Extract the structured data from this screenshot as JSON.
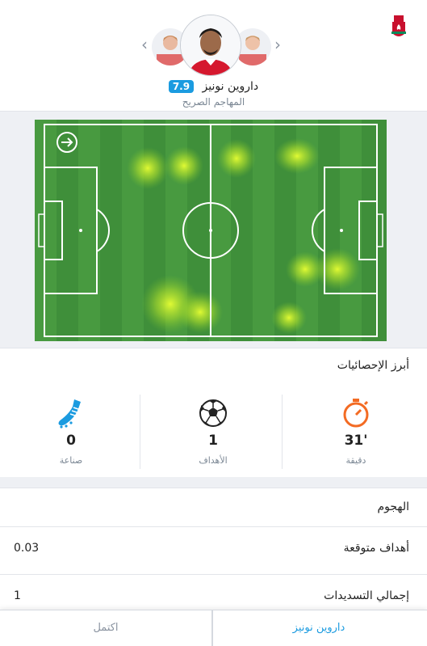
{
  "player": {
    "name": "داروين نونيز",
    "rating": "7.9",
    "position": "المهاجم الصريح"
  },
  "nav": {
    "prev_icon": "chevron-left",
    "next_icon": "chevron-right"
  },
  "club": {
    "logo": "liverpool-crest"
  },
  "stats": {
    "title": "أبرز الإحصائيات",
    "items": [
      {
        "icon": "stopwatch-icon",
        "value": "31'",
        "label": "دقيقة"
      },
      {
        "icon": "soccer-ball-icon",
        "value": "1",
        "label": "الأهداف"
      },
      {
        "icon": "boot-icon",
        "value": "0",
        "label": "صناعة"
      }
    ]
  },
  "attack": {
    "title": "الهجوم",
    "rows": [
      {
        "label": "أهداف متوقعة",
        "value": "0.03"
      },
      {
        "label": "إجمالي التسديدات",
        "value": "1"
      }
    ]
  },
  "tabs": {
    "player": "داروين نونيز",
    "more": "اكتمل"
  },
  "colors": {
    "accent": "#1b9be0",
    "pitch": "#3f8f3a",
    "heat": "#d9ff2a",
    "stopwatch": "#f36b23",
    "boot": "#1b9be0"
  }
}
